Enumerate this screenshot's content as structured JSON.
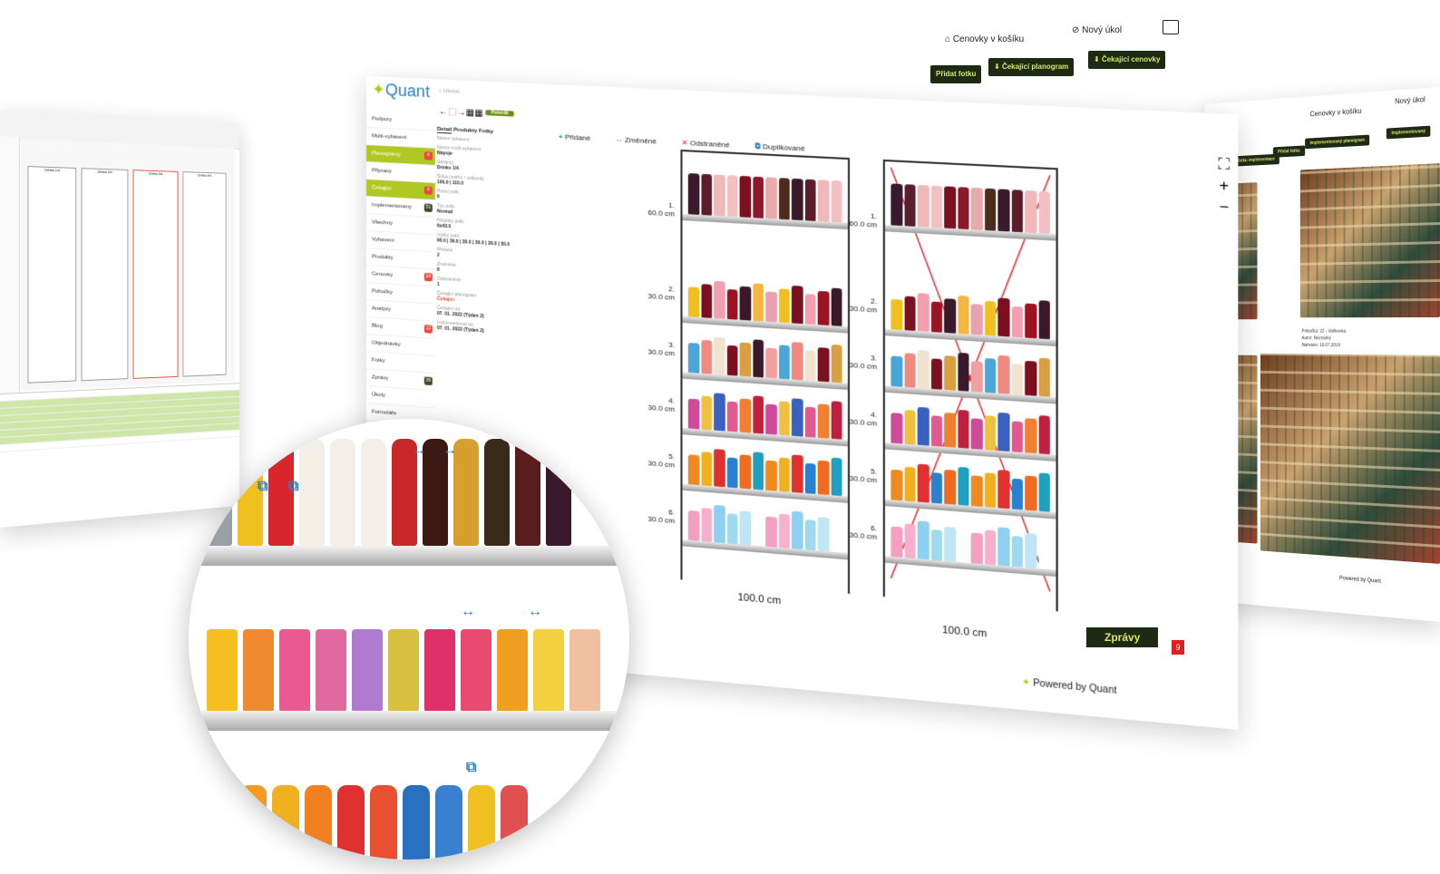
{
  "main": {
    "logo": "Quant",
    "search_placeholder": "Hledat...",
    "confirm_btn": "Potvrdit",
    "top_tabs": [
      "Cenovky v košíku",
      "Nový úkol"
    ],
    "action_btns": [
      "Přidat fotku",
      "Čekající planogram",
      "Čekající cenovky"
    ],
    "nav": [
      {
        "label": "Podpory",
        "badge": ""
      },
      {
        "label": "Multi-vybavení",
        "badge": ""
      },
      {
        "label": "Planogramy",
        "badge": "4",
        "active": true
      },
      {
        "label": "Připravy",
        "badge": ""
      },
      {
        "label": "Čekající",
        "badge": "4",
        "active": true
      },
      {
        "label": "Implementovany",
        "badge": "51",
        "green": true
      },
      {
        "label": "Všechny",
        "badge": ""
      },
      {
        "label": "Vybavení",
        "badge": ""
      },
      {
        "label": "Produkty",
        "badge": ""
      },
      {
        "label": "Cenovky",
        "badge": "24"
      },
      {
        "label": "Pobočky",
        "badge": ""
      },
      {
        "label": "Analýzy",
        "badge": ""
      },
      {
        "label": "Blog",
        "badge": "12"
      },
      {
        "label": "Objednávky",
        "badge": ""
      },
      {
        "label": "Fotky",
        "badge": ""
      },
      {
        "label": "Zprávy",
        "badge": "36",
        "green": true
      },
      {
        "label": "Úkoly",
        "badge": ""
      },
      {
        "label": "Formuláře",
        "badge": ""
      }
    ],
    "detail_tabs": [
      "Detail",
      "Produkty",
      "Fotky"
    ],
    "details": [
      {
        "label": "Název vybavení",
        "value": ""
      },
      {
        "label": "Název multi-vybavení",
        "value": "Nápoje"
      },
      {
        "label": "Varianty",
        "value": "Drinks 1/4"
      },
      {
        "label": "Šířka (vnitřní / celková)",
        "value": "100.0 | 110.0"
      },
      {
        "label": "Počet polic",
        "value": "6"
      },
      {
        "label": "Typ polic",
        "value": "Normal"
      },
      {
        "label": "Hloubky polic",
        "value": "6x43.0"
      },
      {
        "label": "Výšky polic",
        "value": "60.0 | 30.0 | 30.0 | 30.0 | 30.0 | 30.0"
      },
      {
        "label": "Přidané",
        "value": "2"
      },
      {
        "label": "Změněné",
        "value": "8"
      },
      {
        "label": "Odstraněné",
        "value": "1"
      },
      {
        "label": "Čekající planogram",
        "value": "Čekající"
      },
      {
        "label": "Čekající od",
        "value": "07. 01. 2022 (Týden 2)"
      },
      {
        "label": "Implementovat do",
        "value": "07. 01. 2022 (Týden 2)"
      }
    ],
    "legend": [
      "Přidané",
      "Změněné",
      "Odstraněné",
      "Duplikované"
    ],
    "shelves": [
      {
        "num": "1.",
        "h": "60.0 cm"
      },
      {
        "num": "2.",
        "h": "30.0 cm"
      },
      {
        "num": "3.",
        "h": "30.0 cm"
      },
      {
        "num": "4.",
        "h": "30.0 cm"
      },
      {
        "num": "5.",
        "h": "30.0 cm"
      },
      {
        "num": "6.",
        "h": "30.0 cm"
      }
    ],
    "width_label": "100.0 cm",
    "powered": "Powered by Quant",
    "messages": "Zprávy",
    "messages_badge": "9"
  },
  "right": {
    "tabs": [
      "Cenovky v košíku",
      "Nový úkol"
    ],
    "btns": [
      "Nahrát fotku implementace",
      "Přidat fotku",
      "Implementovaný planogram",
      "Implementovaný"
    ],
    "photo_info": [
      "Pobočka: 22 - Vaňkovka",
      "Autor: Neznámý",
      "Nahráno: 10.07.2019"
    ],
    "powered": "Powered by Quant"
  },
  "left": {
    "bays": [
      "Drinks 1/4",
      "Drinks 2/4",
      "Drinks 3/4",
      "Drinks 4/4"
    ]
  },
  "colors": {
    "accent": "#b0c922",
    "dark": "#1f2a14",
    "brand": "#2d7fc0",
    "alert": "#e84b3c"
  }
}
